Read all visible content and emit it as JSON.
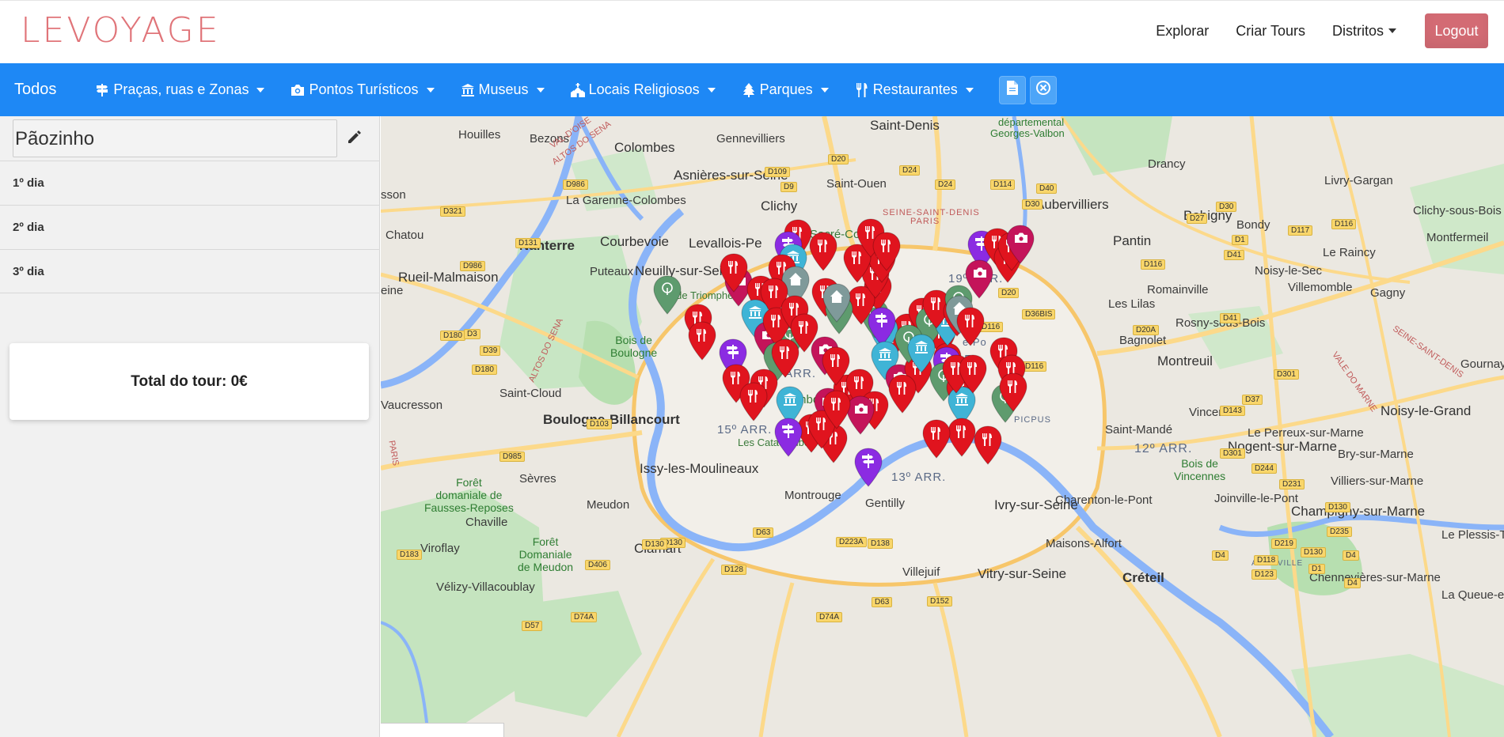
{
  "header": {
    "logo_text": "LEVOYAGE",
    "nav": [
      "Explorar",
      "Criar Tours",
      "Distritos"
    ],
    "logout_label": "Logout",
    "colors": {
      "logo": "#e07479",
      "logout_bg": "#d36b74",
      "catbar_bg": "#1e88f5"
    }
  },
  "catbar": {
    "all_label": "Todos",
    "categories": [
      {
        "label": "Praças, ruas e Zonas",
        "icon": "signpost-icon"
      },
      {
        "label": "Pontos Turísticos",
        "icon": "camera-icon"
      },
      {
        "label": "Museus",
        "icon": "museum-icon"
      },
      {
        "label": "Locais Religiosos",
        "icon": "church-icon"
      },
      {
        "label": "Parques",
        "icon": "tree-icon"
      },
      {
        "label": "Restaurantes",
        "icon": "utensils-icon"
      }
    ],
    "action_icons": [
      "document-icon",
      "close-circle-icon"
    ]
  },
  "tour": {
    "name": "Pãozinho",
    "days": [
      "1º dia",
      "2º dia",
      "3º dia"
    ],
    "total_label": "Total do tour: 0€"
  },
  "map": {
    "labels": {
      "saint_denis": "Saint-Denis",
      "departemental": "départemental",
      "georges_valbon": "Georges-Valbon",
      "drancy": "Drancy",
      "aubervilliers": "Aubervilliers",
      "bobigny": "Bobigny",
      "bondy": "Bondy",
      "livry_gargan": "Livry-Gargan",
      "clichy_sous_bois": "Clichy-sous-Bois",
      "montfermeil": "Montfermeil",
      "le_raincy": "Le Raincy",
      "gagny": "Gagny",
      "villemomble": "Villemomble",
      "noisy_le_sec": "Noisy-le-Sec",
      "romainville": "Romainville",
      "pantin": "Pantin",
      "les_lilas": "Les Lilas",
      "bagnolet": "Bagnolet",
      "rosny": "Rosny-sous-Bois",
      "montreuil": "Montreuil",
      "gournay": "Gournay-su",
      "noisy_le_grand": "Noisy-le-Grand",
      "vincennes": "Vincennes",
      "saint_mande": "Saint-Mandé",
      "le_perreux": "Le Perreux-sur-Marne",
      "bry": "Bry-sur-Marne",
      "nogent": "Nogent-sur-Marne",
      "villiers": "Villiers-sur-Marne",
      "joinville": "Joinville-le-Pont",
      "champigny": "Champigny-sur-Marne",
      "le_plessis": "Le Plessis-Tré",
      "chennevieres": "Chennevières-sur-Marne",
      "la_queue": "La Queue-en",
      "charenton": "Charenton-le-Pont",
      "bois_vincennes": "Bois de\nVincennes",
      "arr12": "12º ARR.",
      "arr13": "13º ARR.",
      "arr15": "15º ARR.",
      "arr19": "19º ARR.",
      "arr7": "7º ARR.",
      "arr11": "1º AR",
      "ivry": "Ivry-sur-Seine",
      "maisons_alfort": "Maisons-Alfort",
      "vitry": "Vitry-sur-Seine",
      "creteil": "Créteil",
      "villejuif": "Villejuif",
      "gentilly": "Gentilly",
      "montrouge": "Montrouge",
      "catacombes": "Les Catacombes de Pa",
      "issy": "Issy-les-Moulineaux",
      "meudon": "Meudon",
      "clamart": "Clamart",
      "chaville": "Chaville",
      "viroflay": "Viroflay",
      "velizy": "Vélizy-Villacoublay",
      "foret_meudon": "Forêt\nDomaniale\nde Meudon",
      "foret_fausses": "Forêt\ndomaniale de\nFausses-Reposes",
      "sevres": "Sèvres",
      "boulogne": "Boulogne-Billancourt",
      "saint_cloud": "Saint-Cloud",
      "vaucresson": "Vaucresson",
      "bois_boulogne": "Bois de\nBoulogne",
      "rueil": "Rueil-Malmaison",
      "nanterre": "Nanterre",
      "puteaux": "Puteaux",
      "neuilly": "Neuilly-sur-Seine",
      "levallois": "Levallois-Pe",
      "clichy": "Clichy",
      "arc": "Arc de Triomphe",
      "chatou": "Chatou",
      "courbevoie": "Courbevoie",
      "la_garenne": "La Garenne-Colombes",
      "colombes": "Colombes",
      "asnieres": "Asnières-sur-Seine",
      "gennevilliers": "Gennevilliers",
      "bezons": "Bezons",
      "houilles": "Houilles",
      "saint_ouen": "Saint-Ouen",
      "sacre_coeur": "Sacré-Cœ",
      "seine_saint_denis": "SEINE-SAINT-DENIS",
      "paris": "PARIS",
      "sson": "sson",
      "eine": "eine",
      "luxembourg": "mbourg",
      "val_doise": "VAL-D'OISE",
      "altos_sena_1": "ALTOS DO SENA",
      "altos_sena_2": "ALTOS DO SENA",
      "paris_side": "PARIS",
      "vale_marne": "VALE DO MARNE",
      "seine_sd_side": "SEINE-SAINT-DENIS",
      "picpus": "PICPUS",
      "adamville": "ADAMVILLE",
      "le_po": "e Po"
    },
    "roads": [
      "D20",
      "D24",
      "D114",
      "D24",
      "D9",
      "D109",
      "D986",
      "D321",
      "D131",
      "D986",
      "D180",
      "D39",
      "D180",
      "D3",
      "D103",
      "D985",
      "D183",
      "D406",
      "D130",
      "D128",
      "D63",
      "D74A",
      "D57",
      "D63",
      "D74A",
      "D130",
      "D223A",
      "D138",
      "D152",
      "D1",
      "D30",
      "D30",
      "D41",
      "D117",
      "D116",
      "D40",
      "D27",
      "D116",
      "D20",
      "D36BIS",
      "D20A",
      "D41",
      "D301",
      "D37",
      "D143",
      "D244",
      "D231",
      "D130",
      "D235",
      "D219",
      "D123",
      "D118",
      "D130",
      "D4",
      "D4",
      "D1",
      "D116",
      "D116",
      "D4",
      "D301"
    ],
    "pin_colors": {
      "restaurant": "#e0141e",
      "museum": "#3fb4d6",
      "park": "#5e9b6e",
      "square": "#8b2be2",
      "attraction": "#c4145a",
      "religious": "#7f9a9a"
    }
  }
}
